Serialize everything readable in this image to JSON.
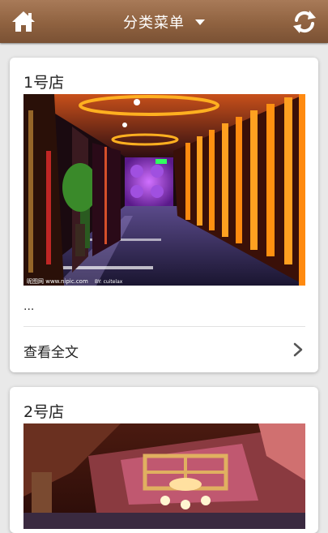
{
  "header": {
    "title": "分类菜单",
    "home_icon": "home-icon",
    "menu_icon": "chevron-down-icon",
    "refresh_icon": "refresh-icon",
    "bg_color": "#8f6240"
  },
  "stores": [
    {
      "name": "1号店",
      "excerpt": "...",
      "read_more": "查看全文",
      "photo_watermark_left": "昵图网 www.nipic.com",
      "photo_watermark_by": "BY: cuitelax"
    },
    {
      "name": "2号店"
    }
  ]
}
